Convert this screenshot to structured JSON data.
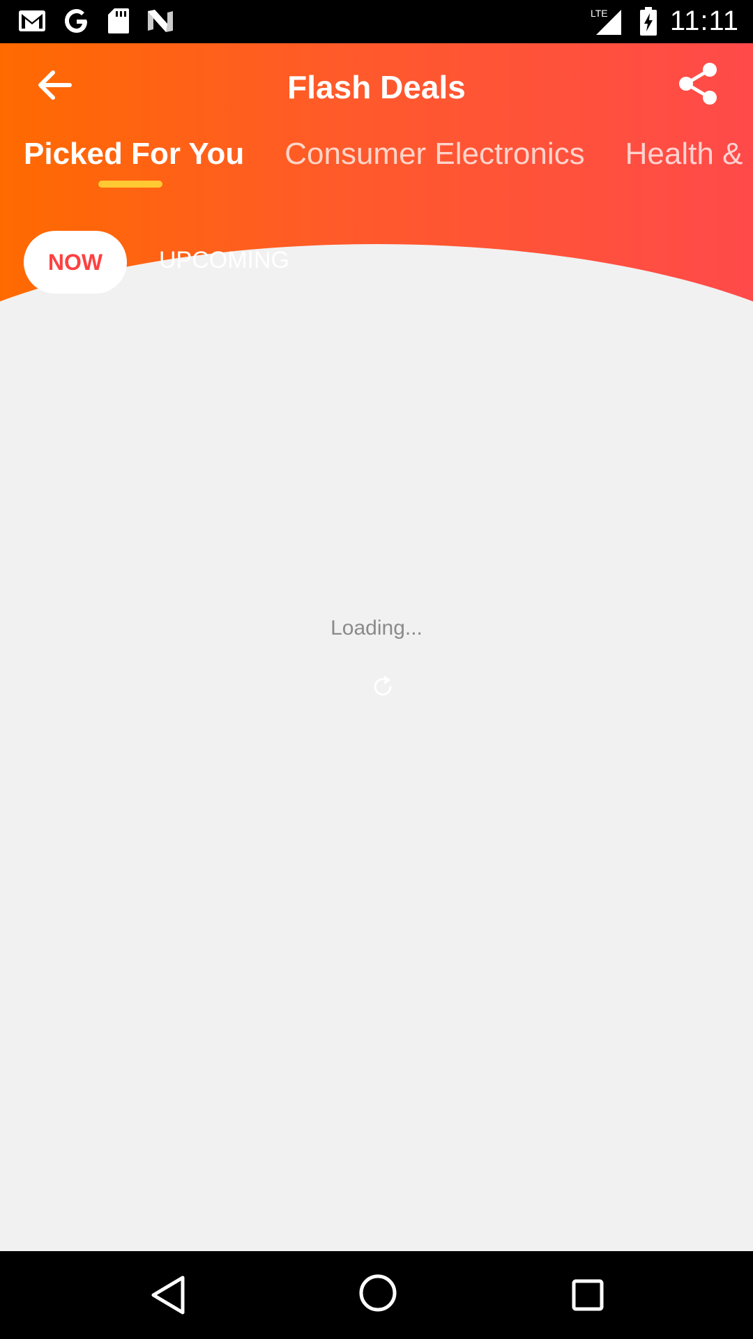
{
  "status_bar": {
    "time": "11:11",
    "network": "LTE",
    "icons": [
      "gmail-icon",
      "google-icon",
      "sd-card-icon",
      "n-icon",
      "signal-icon",
      "battery-charging-icon"
    ]
  },
  "header": {
    "title": "Flash Deals",
    "back_icon": "arrow-left-icon",
    "share_icon": "share-icon"
  },
  "tabs": [
    {
      "label": "Picked For You",
      "active": true
    },
    {
      "label": "Consumer Electronics",
      "active": false
    },
    {
      "label": "Health &",
      "active": false
    }
  ],
  "toggle": {
    "now_label": "NOW",
    "upcoming_label": "UPCOMING"
  },
  "content": {
    "loading_text": "Loading..."
  },
  "colors": {
    "gradient_start": "#ff6a00",
    "gradient_end": "#ff4a4a",
    "tab_indicator": "#ffc933",
    "now_text": "#ff4040",
    "background": "#f1f1f1"
  },
  "nav_bar": {
    "icons": [
      "nav-back-icon",
      "nav-home-icon",
      "nav-recents-icon"
    ]
  }
}
